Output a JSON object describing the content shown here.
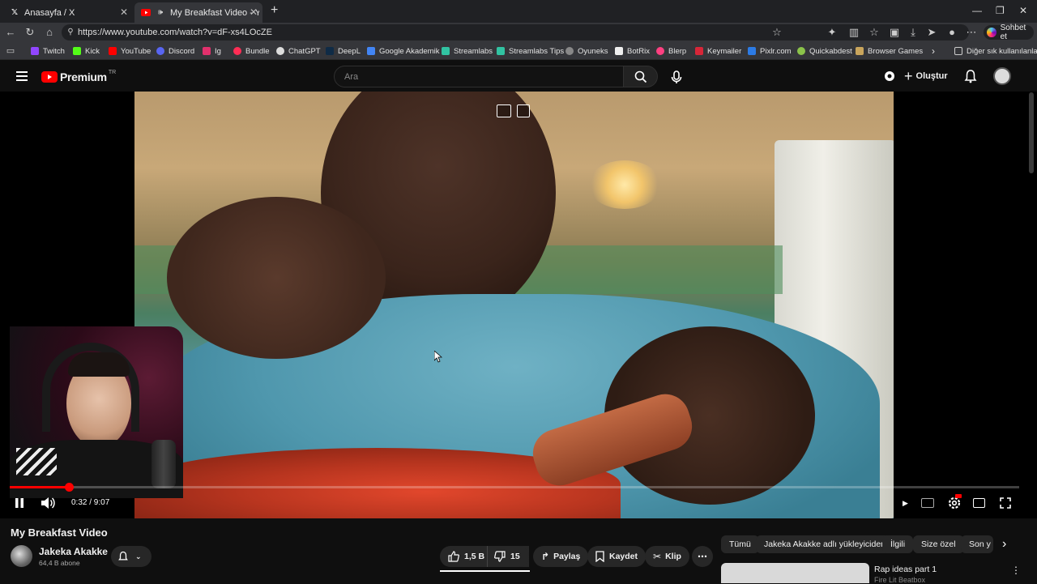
{
  "browser": {
    "tabs": [
      {
        "title": "Anasayfa / X",
        "icon": "x-logo-icon"
      },
      {
        "title": "My Breakfast Video - YouTube",
        "icon": "youtube-icon",
        "active": true
      }
    ],
    "url": "https://www.youtube.com/watch?v=dF-xs4LOcZE",
    "copilot_label": "Sohbet et",
    "bookmarks": [
      "Twitch",
      "Kick",
      "YouTube",
      "Discord",
      "Ig",
      "Bundle",
      "ChatGPT",
      "DeepL",
      "Google Akademik",
      "Streamlabs",
      "Streamlabs Tips",
      "Oyuneks",
      "BotRix",
      "Blerp",
      "Keymailer",
      "Pixlr.com",
      "Quickabdest",
      "Browser Games"
    ],
    "other_bookmarks": "Diğer sık kullanılanlar"
  },
  "youtube": {
    "logo": "Premium",
    "region": "TR",
    "search_placeholder": "Ara",
    "create_label": "Oluştur"
  },
  "player": {
    "current_time": "0:32",
    "duration": "9:07",
    "time_label": "0:32 / 9:07",
    "progress": 0.0585
  },
  "video": {
    "title": "My Breakfast Video",
    "channel": "Jakeka Akakke",
    "subscribers": "64,4 B abone",
    "likes": "1,5 B",
    "dislikes": "15",
    "share_label": "Paylaş",
    "save_label": "Kaydet",
    "clip_label": "Klip"
  },
  "filter_chips": [
    "Tümü",
    "Jakeka Akakke adlı yükleyiciden",
    "İlgili",
    "Size özel",
    "Son y"
  ],
  "recommendation": {
    "title": "Rap ideas part 1",
    "channel": "Fire Lit Beatbox"
  },
  "colors": {
    "youtube_red": "#ff0000",
    "background": "#0f0f0f",
    "pill": "#272727"
  }
}
